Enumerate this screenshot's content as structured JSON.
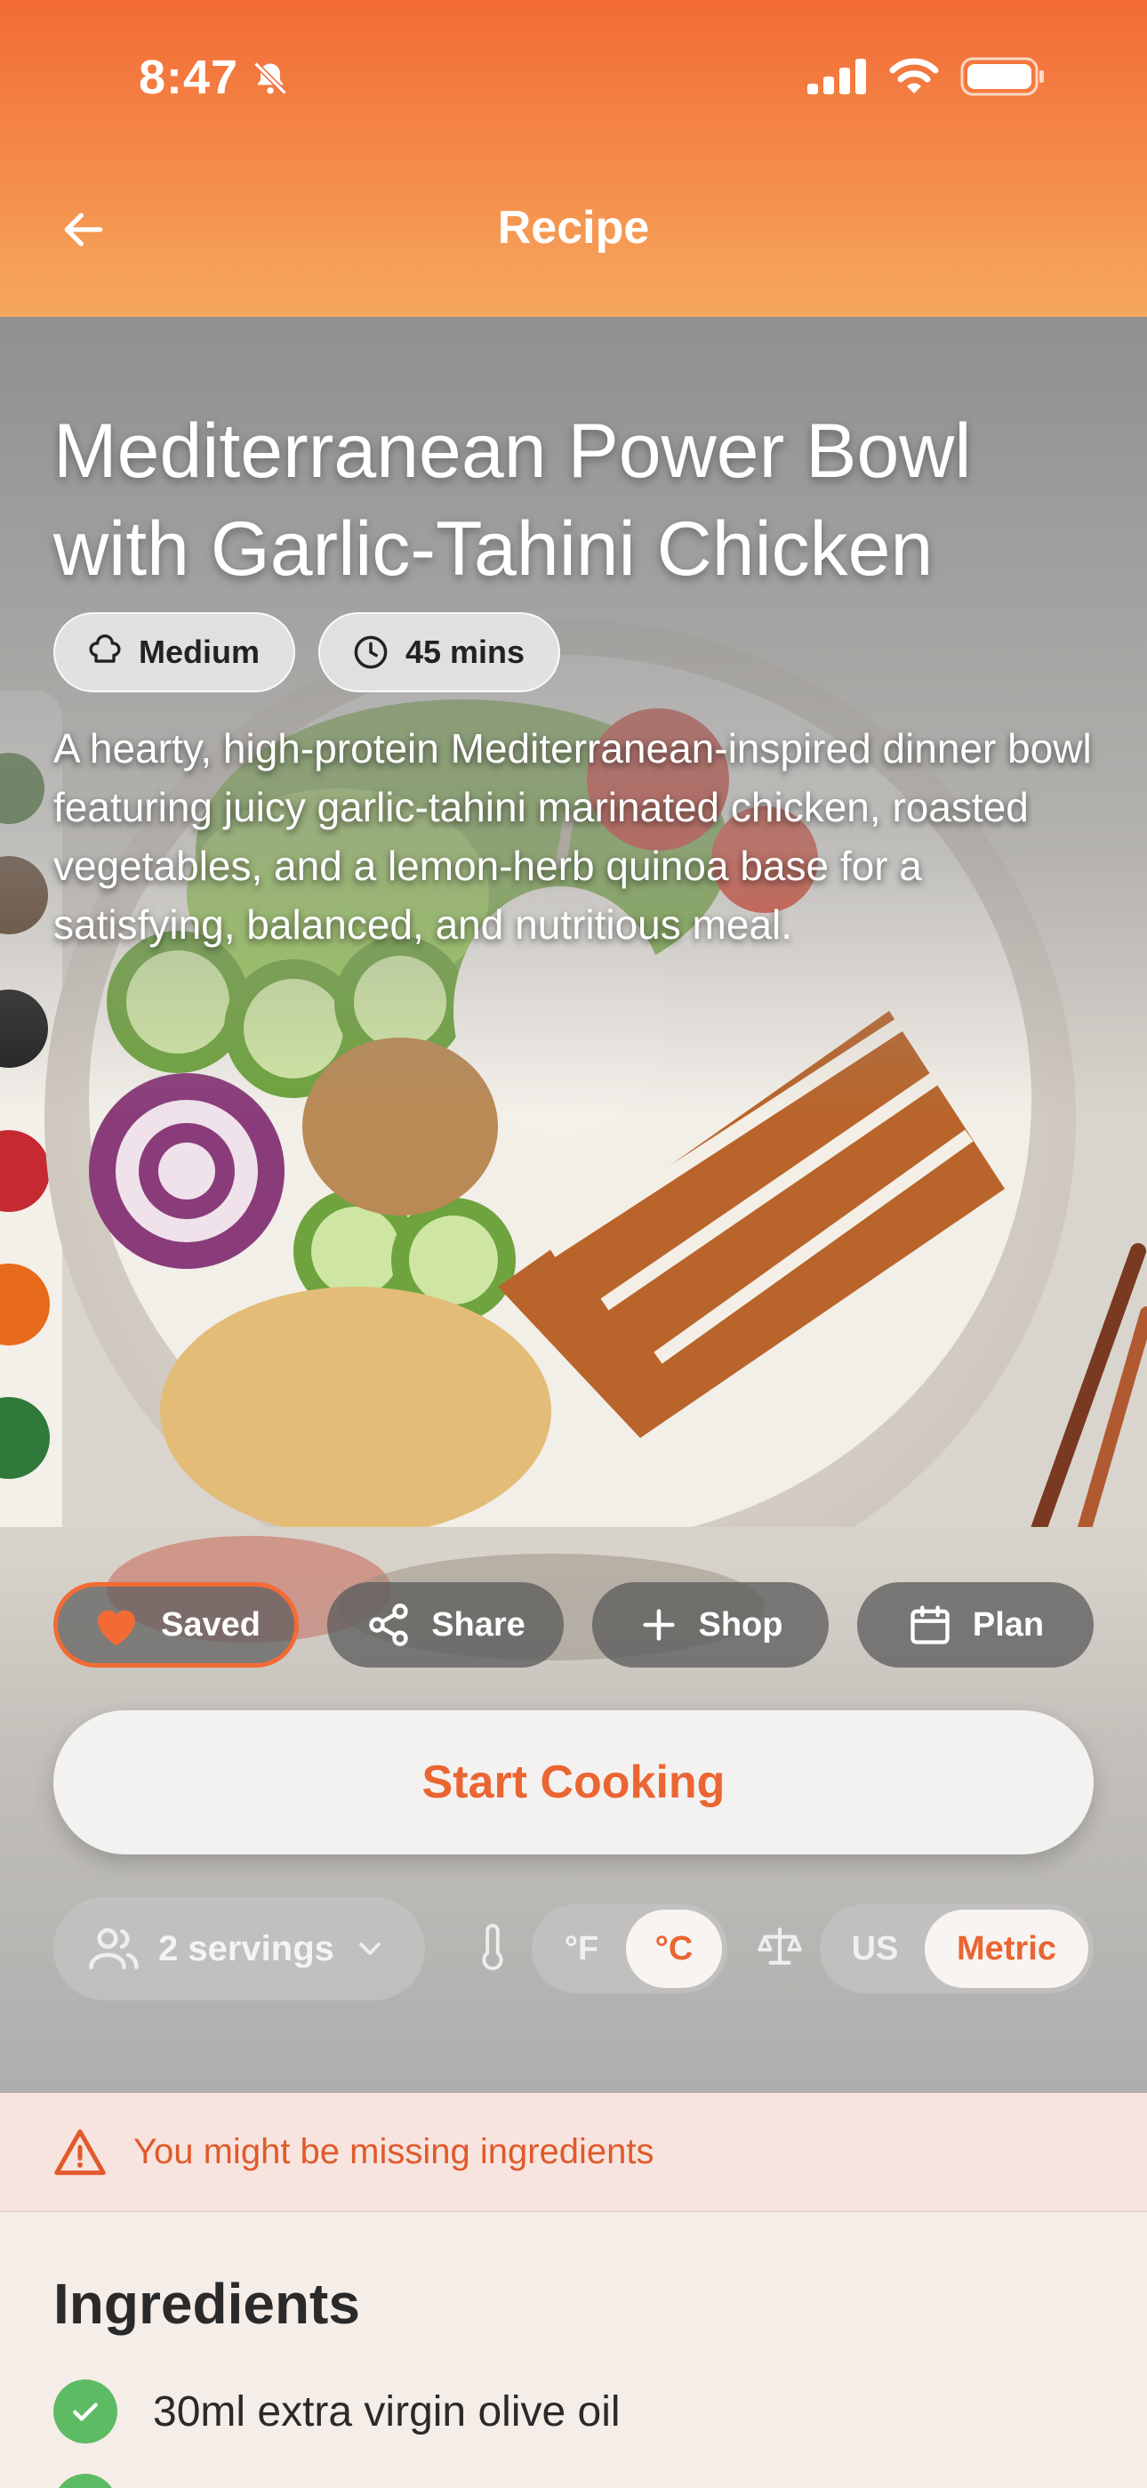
{
  "status_bar": {
    "time": "8:47"
  },
  "nav": {
    "title": "Recipe"
  },
  "recipe": {
    "name_line1": "Mediterranean Power Bowl",
    "name_line2": "with Garlic-Tahini Chicken",
    "difficulty": "Medium",
    "duration": "45 mins",
    "description": "A hearty, high-protein Mediterranean-inspired dinner bowl featuring juicy garlic-tahini marinated chicken, roasted vegetables, and a lemon-herb quinoa base for a satisfying, balanced, and nutritious meal."
  },
  "actions": {
    "saved": "Saved",
    "share": "Share",
    "shop": "Shop",
    "plan": "Plan"
  },
  "start_button": "Start Cooking",
  "settings": {
    "servings": "2 servings",
    "temp_f": "°F",
    "temp_c": "°C",
    "unit_us": "US",
    "unit_metric": "Metric"
  },
  "warning": "You might be missing ingredients",
  "ingredients": {
    "title": "Ingredients",
    "items": [
      "30ml extra virgin olive oil"
    ]
  },
  "colors": {
    "accent": "#EA6531",
    "check": "#5DBB64",
    "warning_bg": "#F8E4DF"
  }
}
